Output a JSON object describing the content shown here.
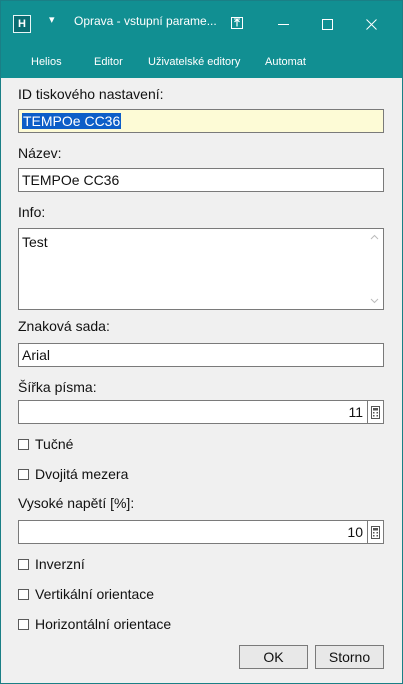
{
  "window": {
    "title": "Oprava - vstupní parame...",
    "app_icon_letter": "H",
    "quick_access_glyph": "▾"
  },
  "menu": {
    "items": [
      {
        "label": "Helios"
      },
      {
        "label": "Editor"
      },
      {
        "label": "Uživatelské editory"
      },
      {
        "label": "Automat"
      }
    ]
  },
  "form": {
    "id_label": "ID tiskového nastavení:",
    "id_value": "TEMPOe CC36",
    "name_label": "Název:",
    "name_value": "TEMPOe CC36",
    "info_label": "Info:",
    "info_value": "Test",
    "charset_label": "Znaková sada:",
    "charset_value": "Arial",
    "font_width_label": "Šířka písma:",
    "font_width_value": "11",
    "bold_label": "Tučné",
    "bold_checked": false,
    "double_space_label": "Dvojitá mezera",
    "double_space_checked": false,
    "high_voltage_label": "Vysoké napětí [%]:",
    "high_voltage_value": "10",
    "inverse_label": "Inverzní",
    "inverse_checked": false,
    "vertical_label": "Vertikální orientace",
    "vertical_checked": false,
    "horizontal_label": "Horizontální orientace",
    "horizontal_checked": false
  },
  "buttons": {
    "ok_label": "OK",
    "cancel_label": "Storno"
  },
  "colors": {
    "titlebar": "#118f92",
    "selection": "#0d5ec8",
    "id_field_background": "#fdfbd6"
  }
}
